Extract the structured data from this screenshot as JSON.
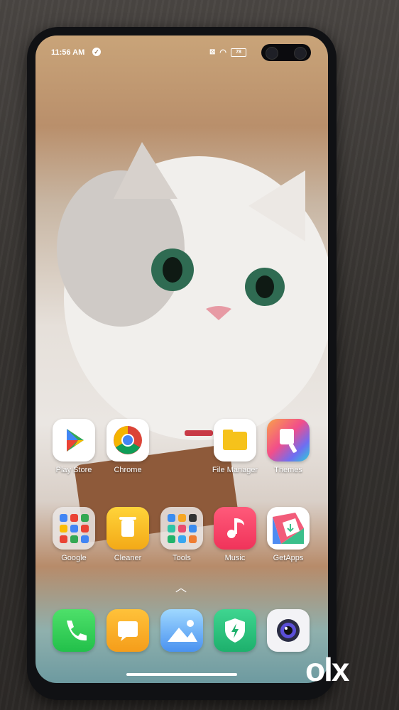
{
  "status_bar": {
    "time": "11:56 AM",
    "battery": "78"
  },
  "apps_row1": [
    {
      "label": "Play Store",
      "icon": "play-store-icon"
    },
    {
      "label": "Chrome",
      "icon": "chrome-icon"
    },
    {
      "label": "File Manager",
      "icon": "folder-icon"
    },
    {
      "label": "Themes",
      "icon": "themes-brush-icon"
    }
  ],
  "apps_row2": [
    {
      "label": "Google",
      "icon": "google-folder-icon"
    },
    {
      "label": "Cleaner",
      "icon": "trash-icon"
    },
    {
      "label": "Tools",
      "icon": "tools-folder-icon"
    },
    {
      "label": "Music",
      "icon": "music-note-icon"
    },
    {
      "label": "GetApps",
      "icon": "getapps-icon"
    }
  ],
  "dock": [
    {
      "icon": "phone-icon"
    },
    {
      "icon": "messages-icon"
    },
    {
      "icon": "gallery-icon"
    },
    {
      "icon": "security-shield-icon"
    },
    {
      "icon": "camera-icon"
    }
  ],
  "watermark": "olx"
}
